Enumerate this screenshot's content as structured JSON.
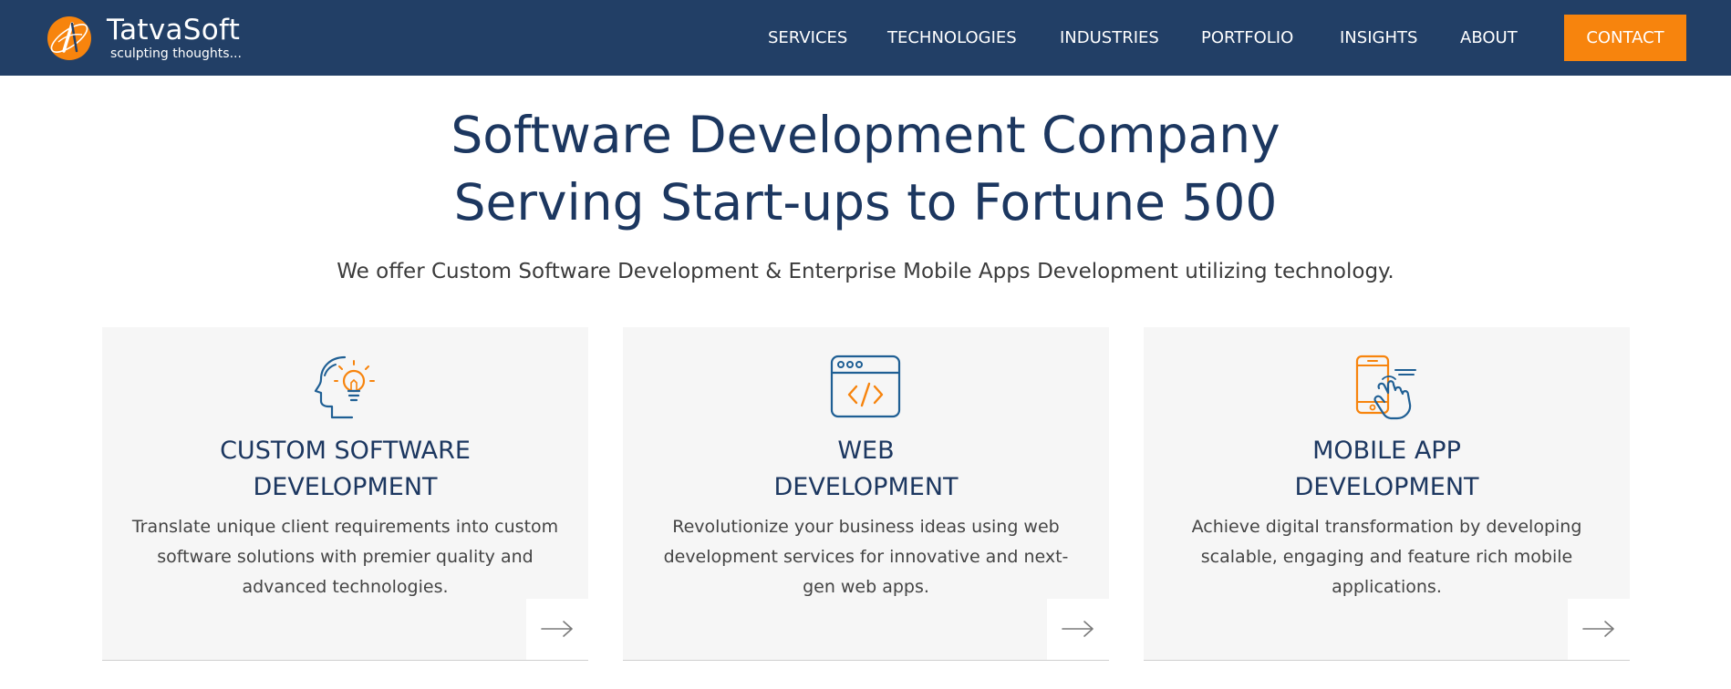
{
  "brand": {
    "name": "TatvaSoft",
    "tagline": "sculpting thoughts...",
    "logo_icon": "globe-logo-icon"
  },
  "nav": {
    "items": [
      {
        "label": "SERVICES"
      },
      {
        "label": "TECHNOLOGIES"
      },
      {
        "label": "INDUSTRIES"
      },
      {
        "label": "PORTFOLIO"
      },
      {
        "label": "INSIGHTS"
      },
      {
        "label": "ABOUT"
      }
    ],
    "contact_label": "CONTACT"
  },
  "hero": {
    "title_line1": "Software Development Company",
    "title_line2": "Serving Start-ups to Fortune 500",
    "subtitle": "We offer Custom Software Development & Enterprise Mobile Apps Development utilizing technology."
  },
  "cards": [
    {
      "icon": "head-lightbulb-icon",
      "title_line1": "CUSTOM SOFTWARE",
      "title_line2": "DEVELOPMENT",
      "desc_line1": "Translate unique client requirements into custom",
      "desc_line2": "software solutions with premier quality and",
      "desc_line3": "advanced technologies.",
      "arrow_icon": "arrow-right-icon"
    },
    {
      "icon": "browser-code-icon",
      "title_line1": "WEB",
      "title_line2": "DEVELOPMENT",
      "desc_line1": "Revolutionize your business ideas using web",
      "desc_line2": "development services for innovative and next-",
      "desc_line3": "gen web apps.",
      "arrow_icon": "arrow-right-icon"
    },
    {
      "icon": "mobile-touch-icon",
      "title_line1": "MOBILE APP",
      "title_line2": "DEVELOPMENT",
      "desc_line1": "Achieve digital transformation by developing",
      "desc_line2": "scalable, engaging and feature rich mobile",
      "desc_line3": "applications.",
      "arrow_icon": "arrow-right-icon"
    }
  ],
  "colors": {
    "header_bg": "#223f66",
    "accent_orange": "#f7840d",
    "heading_navy": "#1c3760",
    "icon_blue": "#1f5f94",
    "card_bg": "#f6f6f6"
  }
}
